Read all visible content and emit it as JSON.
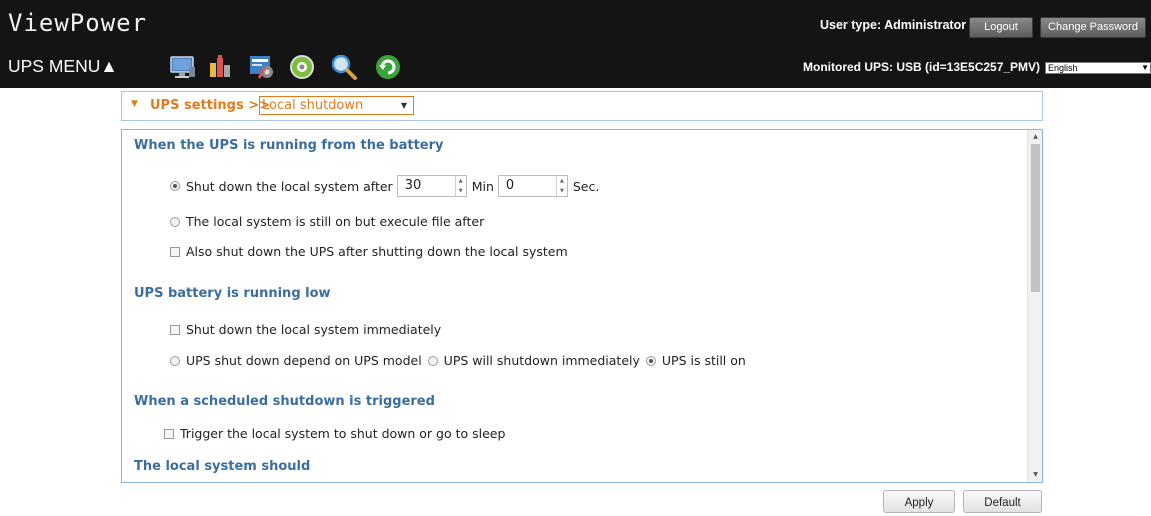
{
  "header": {
    "app_title": "ViewPower",
    "user_type": "User type: Administrator",
    "logout_label": "Logout",
    "change_password_label": "Change Password",
    "menu_label": "UPS MENU▲",
    "monitored_ups": "Monitored UPS: USB (id=13E5C257_PMV)",
    "language": "English",
    "toolbar_icons": [
      "monitor-icon",
      "data-log-icon",
      "configuration-icon",
      "control-icon",
      "search-icon",
      "refresh-icon"
    ]
  },
  "breadcrumb": {
    "label": "UPS settings >>",
    "selected_page": "Local shutdown"
  },
  "sections": {
    "battery": {
      "title": "When the UPS is running from the battery",
      "shutdown_after_label": "Shut down the local system after",
      "minutes_value": "30",
      "min_unit": "Min",
      "seconds_value": "0",
      "sec_unit": "Sec.",
      "execute_file_label": "The local system is still on but execule file after",
      "also_shutdown_ups_label": "Also shut down the UPS after shutting down the local system"
    },
    "low_battery": {
      "title": "UPS battery is running low",
      "shutdown_immediately_label": "Shut down the local system immediately",
      "depend_model_label": "UPS shut down depend on UPS model",
      "ups_shutdown_immediately_label": "UPS will shutdown immediately",
      "ups_still_on_label": "UPS is still on"
    },
    "scheduled": {
      "title": "When a scheduled shutdown is triggered",
      "trigger_label": "Trigger the local system to shut down or go to sleep"
    },
    "local_system": {
      "title": "The local system should"
    }
  },
  "buttons": {
    "apply": "Apply",
    "default": "Default"
  },
  "colors": {
    "header_bg": "#141414",
    "section_title": "#3b6e9e",
    "accent_orange": "#e07b1e",
    "panel_border": "#8eb4d9"
  }
}
